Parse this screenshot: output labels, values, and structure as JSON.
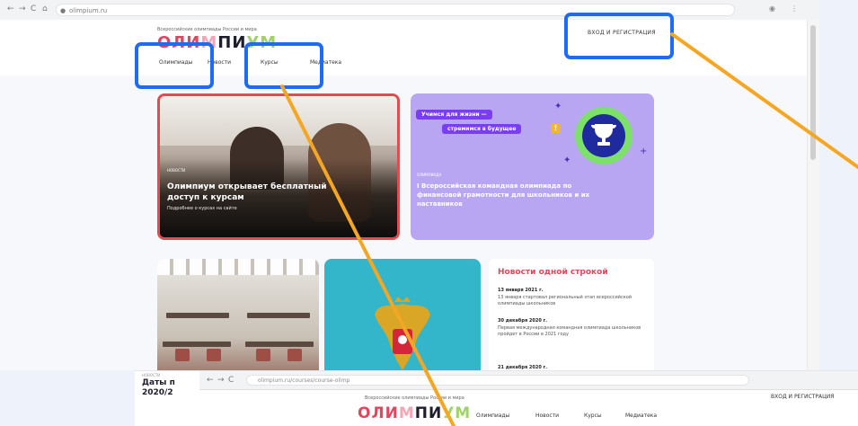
{
  "browser": {
    "url": "olimpium.ru",
    "nav_back": "←",
    "nav_forward": "→",
    "nav_reload": "C",
    "home_icon": "⌂",
    "lock_icon": "lock-icon",
    "menu_glyph": "⋮"
  },
  "site": {
    "tagline": "Всероссийские олимпиады России и мира",
    "logo": {
      "part1": "ОЛИ",
      "part2": "М",
      "part3": "ПИ",
      "part4": "УМ"
    },
    "login_label": "ВХОД И РЕГИСТРАЦИЯ",
    "nav": [
      {
        "label": "Олимпиады"
      },
      {
        "label": "Новости"
      },
      {
        "label": "Курсы"
      },
      {
        "label": "Медиатека"
      }
    ]
  },
  "cards": {
    "photo": {
      "tag": "НОВОСТИ",
      "title": "Олимпиум открывает бесплатный доступ к курсам",
      "subtitle": "Подробнее о курсах на сайте"
    },
    "purple": {
      "slogan_1": "Учимся для жизни —",
      "slogan_2": "стремимся в будущее",
      "alert": "!",
      "tag": "ОЛИМПИАДА",
      "title": "I Всероссийская командная олимпиада по финансовой грамотности для школьников и их наставников"
    }
  },
  "news": {
    "heading": "Новости одной строкой",
    "items": [
      {
        "date": "13 января 2021 г.",
        "text": "13 января стартовал региональный этап всероссийской олимпиады школьников"
      },
      {
        "date": "30 декабря 2020 г.",
        "text": "Первая международная командная олимпиада школьников пройдет в России в 2021 году"
      },
      {
        "date": "21 декабря 2020 г.",
        "text": ""
      }
    ]
  },
  "second_window": {
    "small_tag": "НОВОСТИ",
    "date_title_line1": "Даты п",
    "date_title_line2": "2020/2",
    "url": "olimpium.ru/courses/course-olimp",
    "tagline": "Всероссийские олимпиады России и мира",
    "logo": {
      "part1": "ОЛИ",
      "part2": "М",
      "part3": "ПИ",
      "part4": "УМ"
    },
    "nav": [
      {
        "label": "Олимпиады"
      },
      {
        "label": "Новости"
      },
      {
        "label": "Курсы"
      },
      {
        "label": "Медиатека"
      }
    ],
    "login_label": "ВХОД И РЕГИСТРАЦИЯ"
  },
  "colors": {
    "highlight": "#1e6cf5",
    "arrow": "#f5a623",
    "brand_red": "#e0465e",
    "purple_card": "#b8a6f2",
    "coat_card": "#33b6c9"
  }
}
